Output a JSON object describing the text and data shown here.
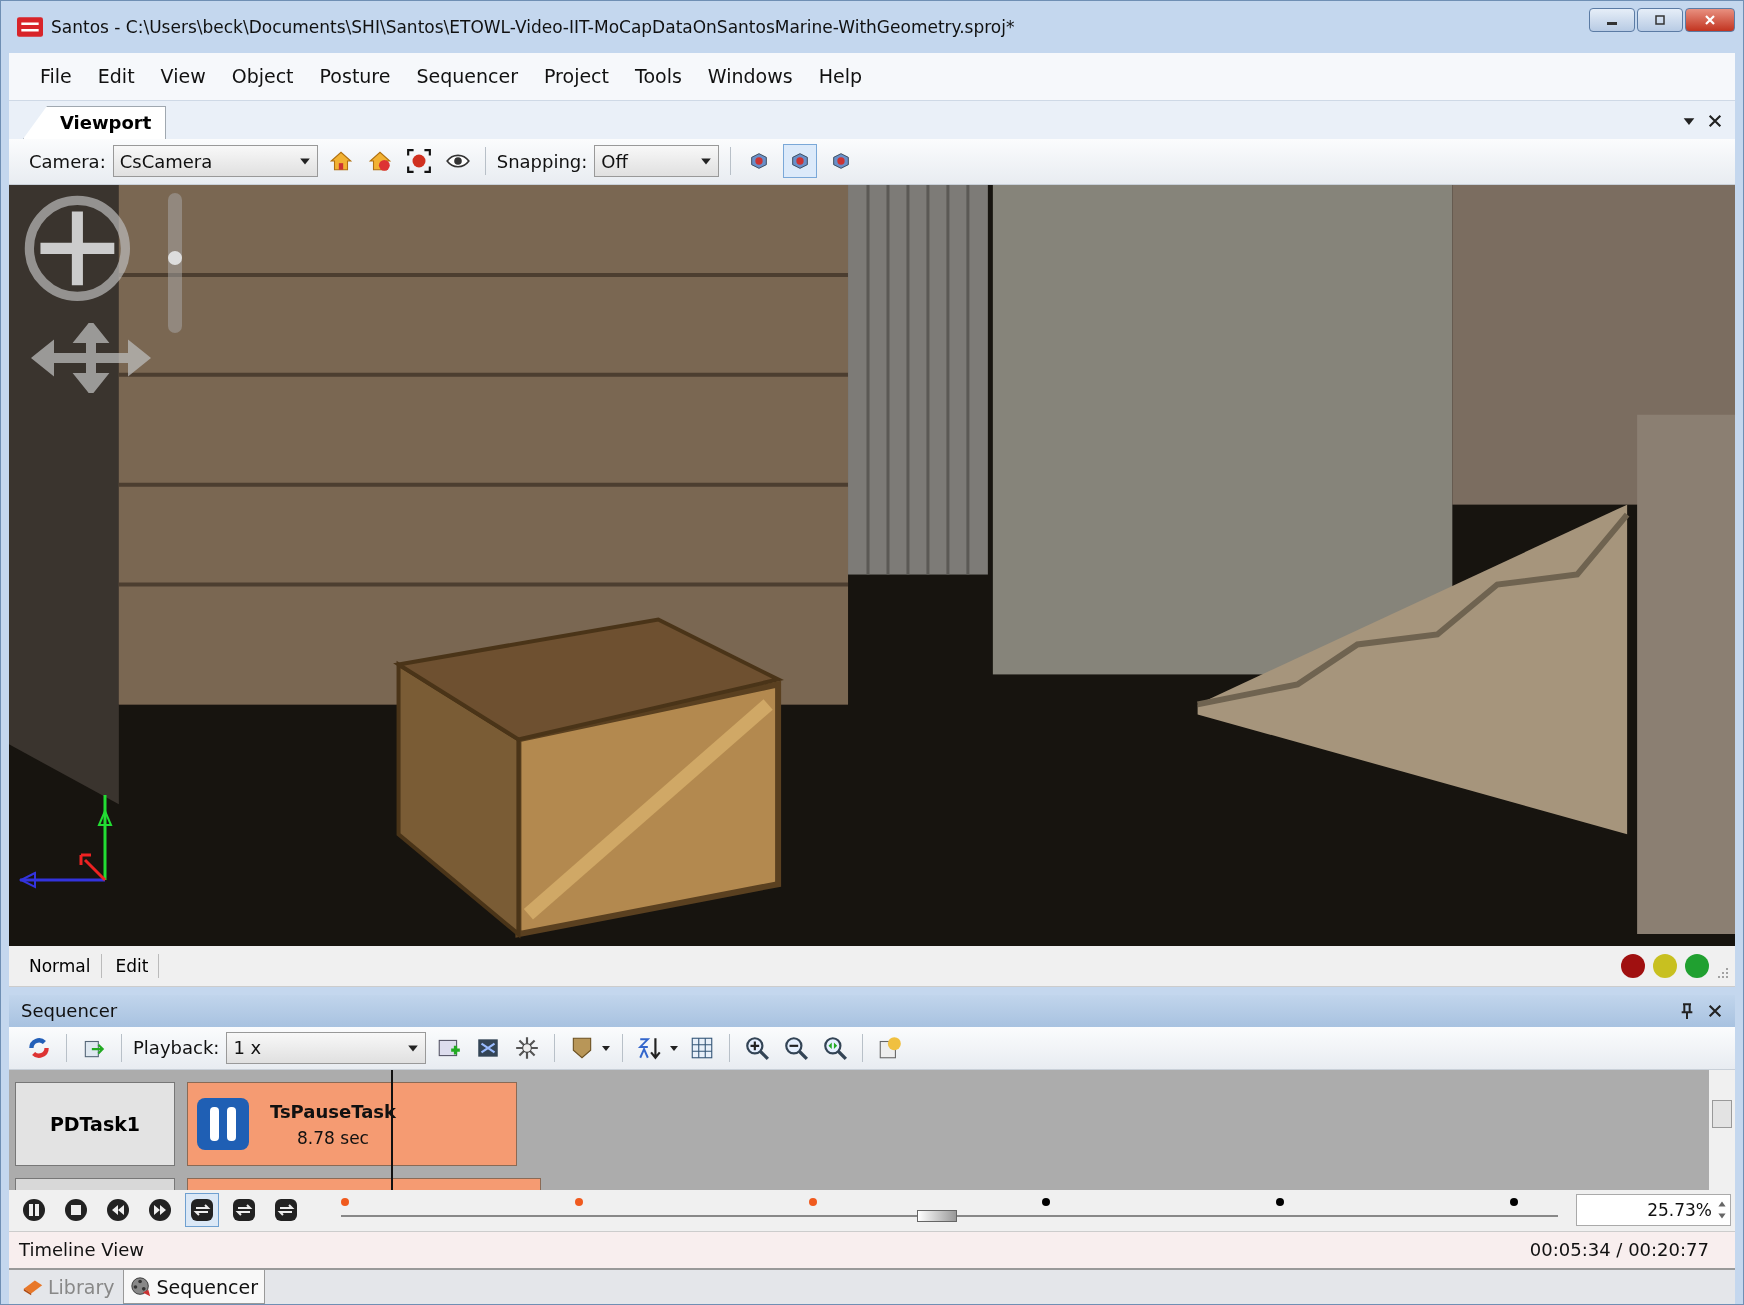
{
  "window": {
    "title": "Santos - C:\\Users\\beck\\Documents\\SHI\\Santos\\ETOWL-Video-IIT-MoCapDataOnSantosMarine-WithGeometry.sproj*"
  },
  "menu": [
    "File",
    "Edit",
    "View",
    "Object",
    "Posture",
    "Sequencer",
    "Project",
    "Tools",
    "Windows",
    "Help"
  ],
  "viewport": {
    "tab": {
      "label": "Viewport",
      "selected": true
    },
    "camera_label": "Camera:",
    "camera": "CsCamera",
    "snapping_label": "Snapping:",
    "snapping": "Off",
    "view_buttons": [
      {
        "selected": false
      },
      {
        "selected": true
      },
      {
        "selected": false
      }
    ],
    "modes": [
      "Normal",
      "Edit"
    ],
    "lights": [
      {
        "color": "#a01010"
      },
      {
        "color": "#c8c020"
      },
      {
        "color": "#20a030"
      }
    ]
  },
  "sequencer": {
    "title": "Sequencer",
    "playback_label": "Playback:",
    "playback": "1 x",
    "tracks": [
      {
        "name": "PDTask1",
        "task": "TsPauseTask",
        "duration": "8.78 sec"
      }
    ],
    "mode_buttons": [
      {
        "selected": true
      },
      {
        "selected": false
      },
      {
        "selected": false
      }
    ],
    "markers": [
      {
        "color": "#f05a1e"
      },
      {
        "color": "#f05a1e"
      },
      {
        "color": "#f05a1e"
      },
      {
        "color": "#000000"
      },
      {
        "color": "#000000"
      },
      {
        "color": "#000000"
      }
    ],
    "slider": {
      "level": 0.49
    },
    "zoom": "25.73%",
    "status": "Timeline View",
    "time": "00:05:34 / 00:20:77"
  },
  "bottom_tabs": [
    {
      "label": "Library",
      "selected": false
    },
    {
      "label": "Sequencer",
      "selected": true
    }
  ]
}
